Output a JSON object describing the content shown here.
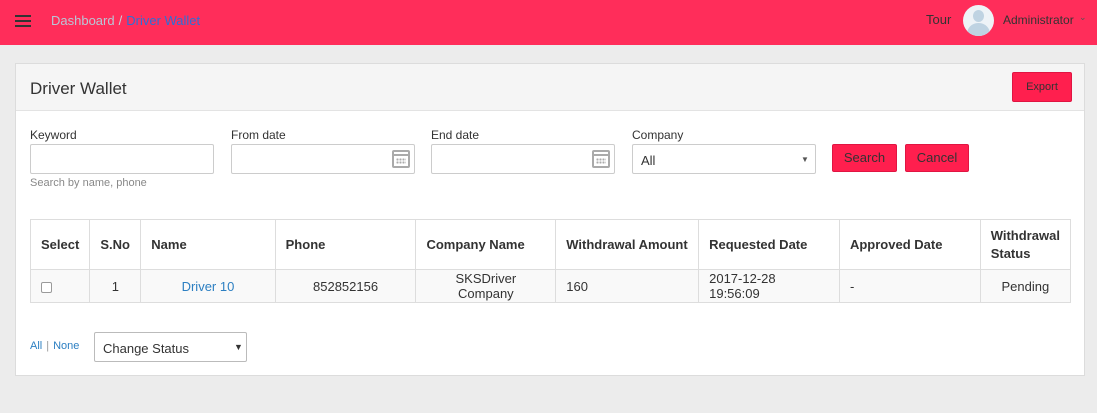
{
  "topbar": {
    "breadcrumb_home": "Dashboard",
    "breadcrumb_sep": "/",
    "breadcrumb_current": "Driver Wallet",
    "tour_label": "Tour",
    "user_name": "Administrator",
    "accent_color": "#ff2d5a"
  },
  "panel": {
    "title": "Driver Wallet",
    "export_label": "Export"
  },
  "filters": {
    "keyword_label": "Keyword",
    "keyword_value": "",
    "keyword_hint": "Search by name, phone",
    "from_date_label": "From date",
    "from_date_value": "",
    "end_date_label": "End date",
    "end_date_value": "",
    "company_label": "Company",
    "company_value": "All",
    "search_label": "Search",
    "cancel_label": "Cancel"
  },
  "table": {
    "headers": {
      "select": "Select",
      "sno": "S.No",
      "name": "Name",
      "phone": "Phone",
      "company": "Company Name",
      "amount": "Withdrawal Amount",
      "requested": "Requested Date",
      "approved": "Approved Date",
      "status": "Withdrawal Status"
    },
    "rows": [
      {
        "sno": "1",
        "name": "Driver 10",
        "phone": "852852156",
        "company": "SKSDriver Company",
        "amount": "160",
        "requested": "2017-12-28 19:56:09",
        "approved": "-",
        "status": "Pending"
      }
    ]
  },
  "footer": {
    "all_label": "All",
    "sep": "|",
    "none_label": "None",
    "status_select_value": "Change Status"
  }
}
